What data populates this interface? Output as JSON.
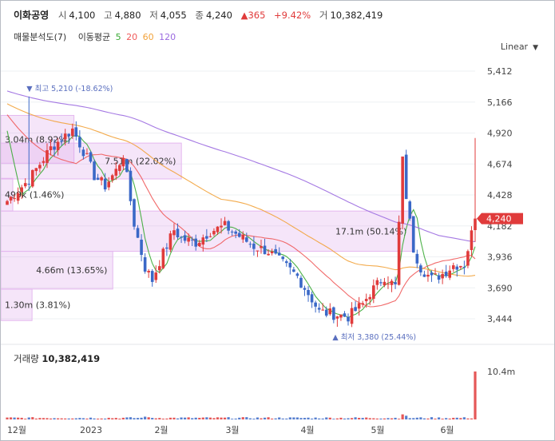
{
  "header": {
    "stock_name": "이화공영",
    "open_label": "시",
    "open_value": "4,100",
    "high_label": "고",
    "high_value": "4,880",
    "low_label": "저",
    "low_value": "4,055",
    "close_label": "종",
    "close_value": "4,240",
    "change_arrow": "▲",
    "change_value": "365",
    "change_pct": "+9.42%",
    "volume_label": "거",
    "volume_value": "10,382,419"
  },
  "indicators": {
    "profile_label": "매물분석도(7)",
    "ma_label": "이동평균",
    "ma_periods": [
      "5",
      "20",
      "60",
      "120"
    ],
    "ma_colors": [
      "#3aaa35",
      "#f05a5a",
      "#f2a23a",
      "#9b6ae0"
    ]
  },
  "scale_label": "Linear",
  "colors": {
    "up": "#e03b3b",
    "down": "#3a68c7",
    "profile": "#c79be8",
    "annotation": "#5a6fbf"
  },
  "chart_data": {
    "type": "candlestick",
    "y_ticks": [
      "5,412",
      "5,166",
      "4,920",
      "4,674",
      "4,428",
      "4,182",
      "3,936",
      "3,690",
      "3,444"
    ],
    "ylim": [
      3300,
      5550
    ],
    "x_ticks": [
      "12월",
      "2023",
      "2월",
      "3월",
      "4월",
      "5월",
      "6월"
    ],
    "last_price_label": "4,240",
    "last_price": 4240,
    "high_annotation": {
      "marker": "▼",
      "label": "최고",
      "value": "5,210",
      "pct": "(-18.62%)"
    },
    "low_annotation": {
      "marker": "▲",
      "label": "최저",
      "value": "3,380",
      "pct": "(25.44%)"
    },
    "volume_profile": [
      {
        "label": "3.04m (8.92%)",
        "low": 4680,
        "high": 5060,
        "pct": 8.92
      },
      {
        "label": "7.51m (22.02%)",
        "low": 4555,
        "high": 4840,
        "pct": 22.02
      },
      {
        "label": "499k (1.46%)",
        "low": 4300,
        "high": 4560,
        "pct": 1.46
      },
      {
        "label": "17.1m (50.14%)",
        "low": 3980,
        "high": 4300,
        "pct": 50.14
      },
      {
        "label": "4.66m (13.65%)",
        "low": 3680,
        "high": 3980,
        "pct": 13.65
      },
      {
        "label": "1.30m (3.81%)",
        "low": 3430,
        "high": 3680,
        "pct": 3.81
      }
    ],
    "volume_panel": {
      "title": "거래량",
      "value": "10,382,419",
      "axis_tick": "10.4m",
      "last_volume_m": 10.38
    }
  }
}
